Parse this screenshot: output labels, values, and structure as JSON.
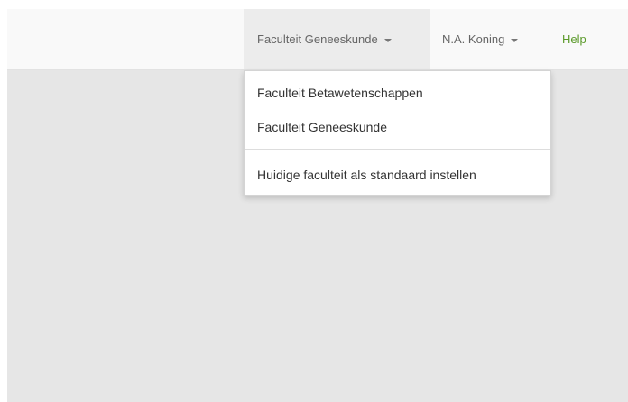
{
  "navbar": {
    "faculty_menu": {
      "label": "Faculteit Geneeskunde",
      "icon": "caret-down-icon"
    },
    "user_menu": {
      "label": "N.A. Koning",
      "icon": "caret-down-icon"
    },
    "help_link": {
      "label": "Help"
    }
  },
  "dropdown": {
    "items": [
      {
        "label": "Faculteit Betawetenschappen"
      },
      {
        "label": "Faculteit Geneeskunde"
      }
    ],
    "set_default_label": "Huidige faculteit als standaard instellen"
  },
  "colors": {
    "page_background": "#e6e6e6",
    "navbar_background": "#f9f9f9",
    "help_link": "#5b9a2a",
    "menu_text": "#333333"
  }
}
